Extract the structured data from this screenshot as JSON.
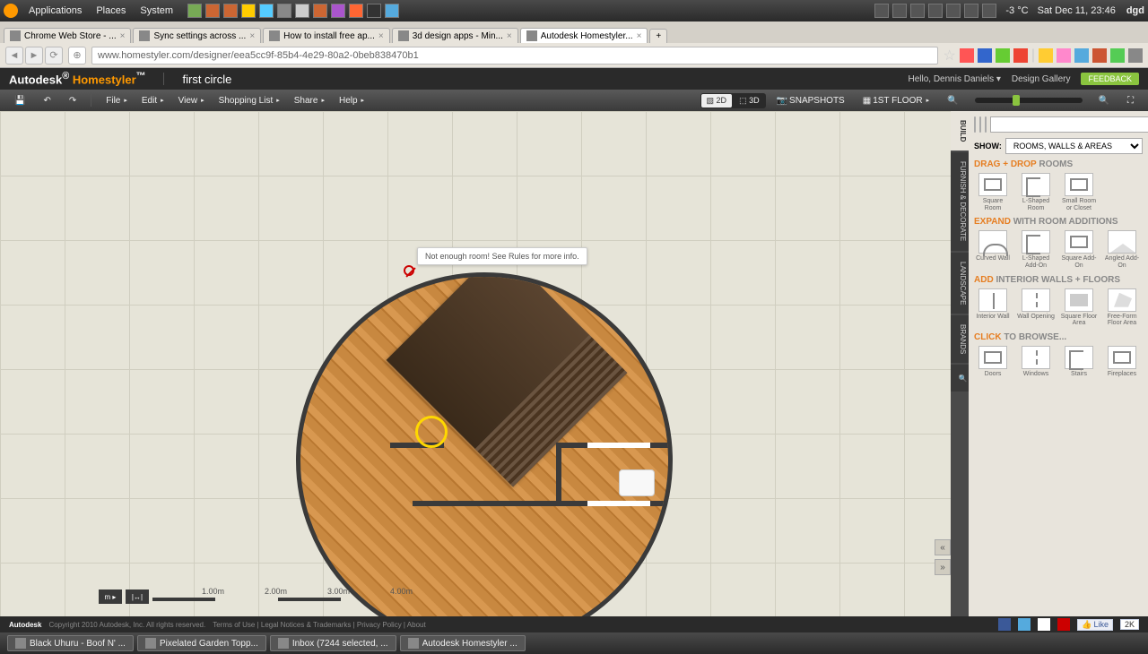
{
  "system": {
    "menus": [
      "Applications",
      "Places",
      "System"
    ],
    "weather": "-3 °C",
    "clock": "Sat Dec 11, 23:46",
    "user": "dgd"
  },
  "browser": {
    "tabs": [
      {
        "label": "Chrome Web Store - ...",
        "active": false
      },
      {
        "label": "Sync settings across ...",
        "active": false
      },
      {
        "label": "How to install free ap...",
        "active": false
      },
      {
        "label": "3d design apps - Min...",
        "active": false
      },
      {
        "label": "Autodesk Homestyler...",
        "active": true
      }
    ],
    "url": "www.homestyler.com/designer/eea5cc9f-85b4-4e29-80a2-0beb838470b1"
  },
  "app": {
    "brand_a": "Autodesk",
    "brand_b": "Homestyler",
    "project": "first circle",
    "hello": "Hello, Dennis Daniels",
    "gallery": "Design Gallery",
    "feedback": "FEEDBACK"
  },
  "toolbar": {
    "left_icons": [
      "save",
      "undo",
      "redo"
    ],
    "menus": [
      "File",
      "Edit",
      "View",
      "Shopping List",
      "Share",
      "Help"
    ],
    "view2d": "2D",
    "view3d": "3D",
    "snapshots": "SNAPSHOTS",
    "floor": "1ST FLOOR"
  },
  "canvas": {
    "tooltip": "Not enough room! See Rules for more info.",
    "ruler": [
      "1.00m",
      "2.00m",
      "3.00m",
      "4.00m"
    ],
    "unit_btn": "m ▸",
    "measure_btn": "|↔|"
  },
  "side": {
    "tabs": [
      "BUILD",
      "FURNISH & DECORATE",
      "LANDSCAPE",
      "BRANDS"
    ],
    "active_tab": 0,
    "show_label": "SHOW:",
    "show_value": "ROOMS, WALLS & AREAS",
    "sections": {
      "rooms": {
        "head_a": "Drag + Drop",
        "head_b": "Rooms",
        "items": [
          {
            "label": "Square Room",
            "icon": "icon-square"
          },
          {
            "label": "L-Shaped Room",
            "icon": "icon-lshape"
          },
          {
            "label": "Small Room or Closet",
            "icon": "icon-square"
          }
        ]
      },
      "expand": {
        "head_a": "Expand",
        "head_b": "with Room Additions",
        "items": [
          {
            "label": "Curved Wall",
            "icon": "icon-curved"
          },
          {
            "label": "L-Shaped Add-On",
            "icon": "icon-lshape"
          },
          {
            "label": "Square Add-On",
            "icon": "icon-square"
          },
          {
            "label": "Angled Add-On",
            "icon": "icon-angled"
          }
        ]
      },
      "interior": {
        "head_a": "Add",
        "head_b": "Interior Walls + Floors",
        "items": [
          {
            "label": "Interior Wall",
            "icon": "icon-line"
          },
          {
            "label": "Wall Opening",
            "icon": "icon-opening"
          },
          {
            "label": "Square Floor Area",
            "icon": "icon-fill"
          },
          {
            "label": "Free-Form Floor Area",
            "icon": "icon-free"
          }
        ]
      },
      "browse": {
        "head_a": "Click",
        "head_b": "to Browse...",
        "items": [
          {
            "label": "Doors",
            "icon": "icon-square"
          },
          {
            "label": "Windows",
            "icon": "icon-opening"
          },
          {
            "label": "Stairs",
            "icon": "icon-lshape"
          },
          {
            "label": "Fireplaces",
            "icon": "icon-square"
          }
        ]
      }
    }
  },
  "footer": {
    "brand": "Autodesk",
    "copy": "Copyright 2010 Autodesk, Inc. All rights reserved.",
    "links": [
      "Terms of Use",
      "Legal Notices & Trademarks",
      "Privacy Policy",
      "About"
    ],
    "like": "Like",
    "like_count": "2K"
  },
  "taskbar": [
    "Black Uhuru - Boof N' ...",
    "Pixelated Garden Topp...",
    "Inbox (7244 selected, ...",
    "Autodesk Homestyler ..."
  ]
}
